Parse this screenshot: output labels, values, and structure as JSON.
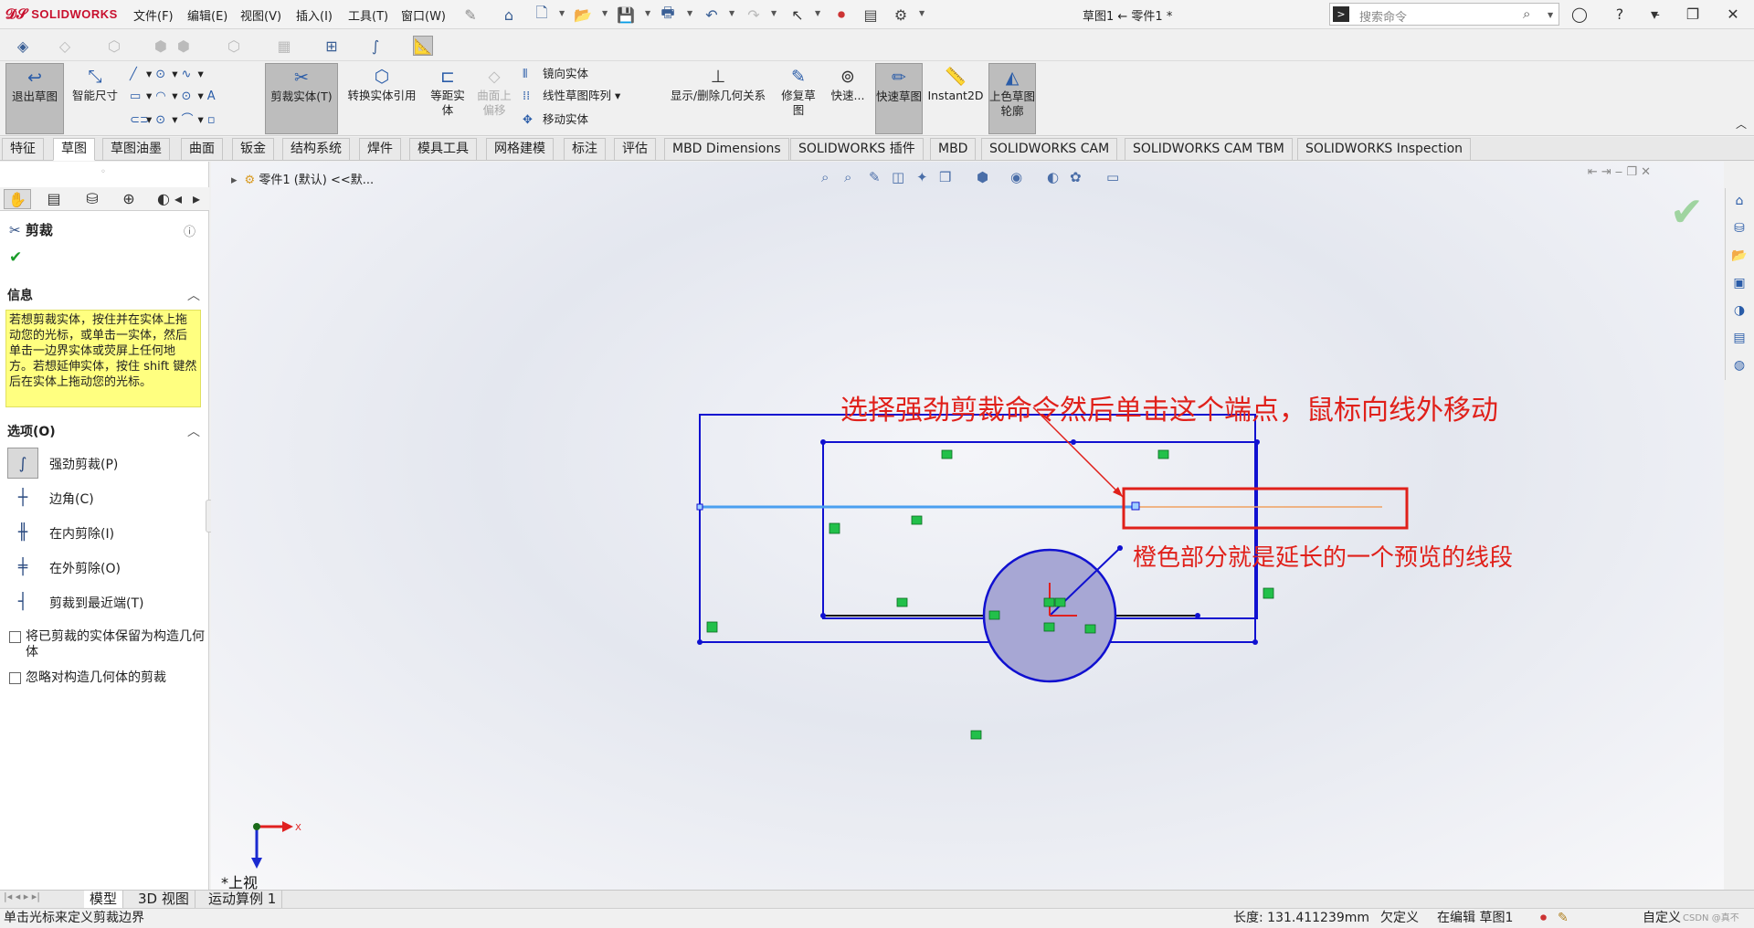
{
  "app": {
    "logo": "SOLIDWORKS",
    "doc_title": "草图1 ← 零件1 *"
  },
  "menu": [
    "文件(F)",
    "编辑(E)",
    "视图(V)",
    "插入(I)",
    "工具(T)",
    "窗口(W)"
  ],
  "search": {
    "placeholder": "搜索命令"
  },
  "ribbon": {
    "exit_sketch": "退出草图",
    "smart_dim": "智能尺寸",
    "trim": "剪裁实体(T)",
    "convert": "转换实体引用",
    "offset": "等距实体",
    "surface_offset": "曲面上偏移",
    "mirror": "镜向实体",
    "linear_pattern": "线性草图阵列",
    "move": "移动实体",
    "show_relations": "显示/删除几何关系",
    "repair": "修复草图",
    "quick_snap": "快速...",
    "rapid_sketch": "快速草图",
    "instant2d": "Instant2D",
    "shaded": "上色草图轮廓"
  },
  "tabs": [
    "特征",
    "草图",
    "草图油墨",
    "曲面",
    "钣金",
    "结构系统",
    "焊件",
    "模具工具",
    "网格建模",
    "标注",
    "评估",
    "MBD Dimensions",
    "SOLIDWORKS 插件",
    "MBD",
    "SOLIDWORKS CAM",
    "SOLIDWORKS CAM TBM",
    "SOLIDWORKS Inspection"
  ],
  "active_tab": "草图",
  "panel": {
    "title": "剪裁",
    "info_header": "信息",
    "info_text": "若想剪裁实体，按住并在实体上拖动您的光标，或单击一实体，然后单击一边界实体或荧屏上任何地方。若想延伸实体，按住 shift 键然后在实体上拖动您的光标。",
    "options_header": "选项(O)",
    "options": [
      "强劲剪裁(P)",
      "边角(C)",
      "在内剪除(I)",
      "在外剪除(O)",
      "剪裁到最近端(T)"
    ],
    "checkbox1": "将已剪裁的实体保留为构造几何体",
    "checkbox2": "忽略对构造几何体的剪裁"
  },
  "breadcrumb": "零件1 (默认) <<默...",
  "annotations": {
    "a1": "选择强劲剪裁命令然后单击这个端点，鼠标向线外移动",
    "a2": "橙色部分就是延长的一个预览的线段"
  },
  "view_label": "*上视",
  "bottom_tabs": [
    "模型",
    "3D 视图",
    "运动算例 1"
  ],
  "status": {
    "left": "单击光标来定义剪裁边界",
    "length": "长度: 131.411239mm",
    "defined": "欠定义",
    "editing": "在编辑 草图1",
    "custom": "自定义",
    "watermark": "CSDN @真不"
  },
  "colors": {
    "sketch_blue": "#1010d0",
    "selected_line": "#4a9ff0",
    "preview": "#f0a060",
    "annotation": "#e0201a",
    "relation_green": "#22c04a"
  },
  "icons": [
    "home-icon",
    "new-icon",
    "open-icon",
    "save-icon",
    "print-icon",
    "undo-icon",
    "redo-icon",
    "select-icon",
    "rebuild-icon",
    "options-icon",
    "user-icon",
    "help-icon"
  ]
}
